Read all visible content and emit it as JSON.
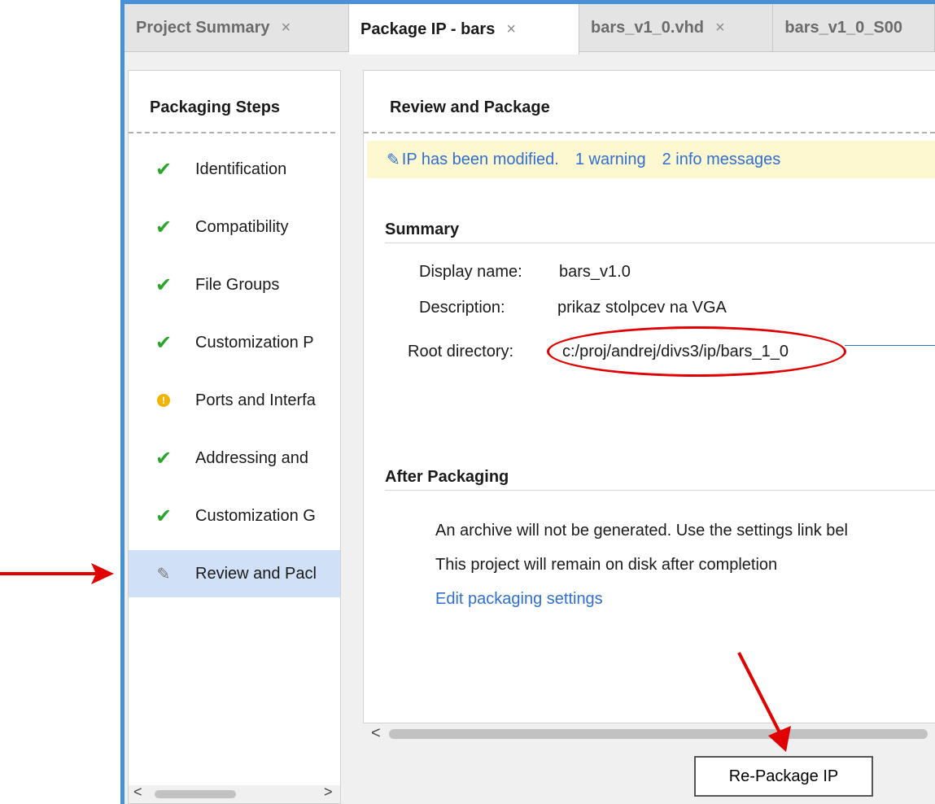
{
  "tabs": [
    {
      "label": "Project Summary",
      "close": "×",
      "active": false
    },
    {
      "label": "Package IP - bars",
      "close": "×",
      "active": true
    },
    {
      "label": "bars_v1_0.vhd",
      "close": "×",
      "active": false
    },
    {
      "label": "bars_v1_0_S00",
      "close": "",
      "active": false
    }
  ],
  "steps_panel": {
    "title": "Packaging Steps",
    "items": [
      {
        "label": "Identification",
        "status": "check"
      },
      {
        "label": "Compatibility",
        "status": "check"
      },
      {
        "label": "File Groups",
        "status": "check"
      },
      {
        "label": "Customization P",
        "status": "check"
      },
      {
        "label": "Ports and Interfa",
        "status": "warning"
      },
      {
        "label": "Addressing and",
        "status": "check"
      },
      {
        "label": "Customization G",
        "status": "check"
      },
      {
        "label": "Review and Pacl",
        "status": "edit",
        "selected": true
      }
    ]
  },
  "main": {
    "title": "Review and Package",
    "banner": {
      "modified": "IP has been modified.",
      "warning_link": "1 warning",
      "info_link": "2 info messages"
    },
    "summary": {
      "heading": "Summary",
      "display_name_label": "Display name:",
      "display_name_value": "bars_v1.0",
      "description_label": "Description:",
      "description_value": "prikaz stolpcev na VGA",
      "root_dir_label": "Root directory:",
      "root_dir_value": "c:/proj/andrej/divs3/ip/bars_1_0"
    },
    "after": {
      "heading": "After Packaging",
      "line1": "An archive will not be generated. Use the settings link bel",
      "line2": "This project will remain on disk after completion",
      "edit_link": "Edit packaging settings"
    },
    "button_label": "Re-Package IP"
  },
  "scroll": {
    "left_arrow": "<",
    "right_arrow": ">"
  },
  "colors": {
    "accent": "#4a90d9",
    "link": "#2f6fd0",
    "check": "#2aa52a",
    "warning": "#f0b400",
    "annotation": "#e00000",
    "banner_bg": "#fdf8cf",
    "selected_bg": "#cfe0f7"
  },
  "icons": {
    "check": "✔",
    "warning": "!",
    "edit": "✎"
  }
}
